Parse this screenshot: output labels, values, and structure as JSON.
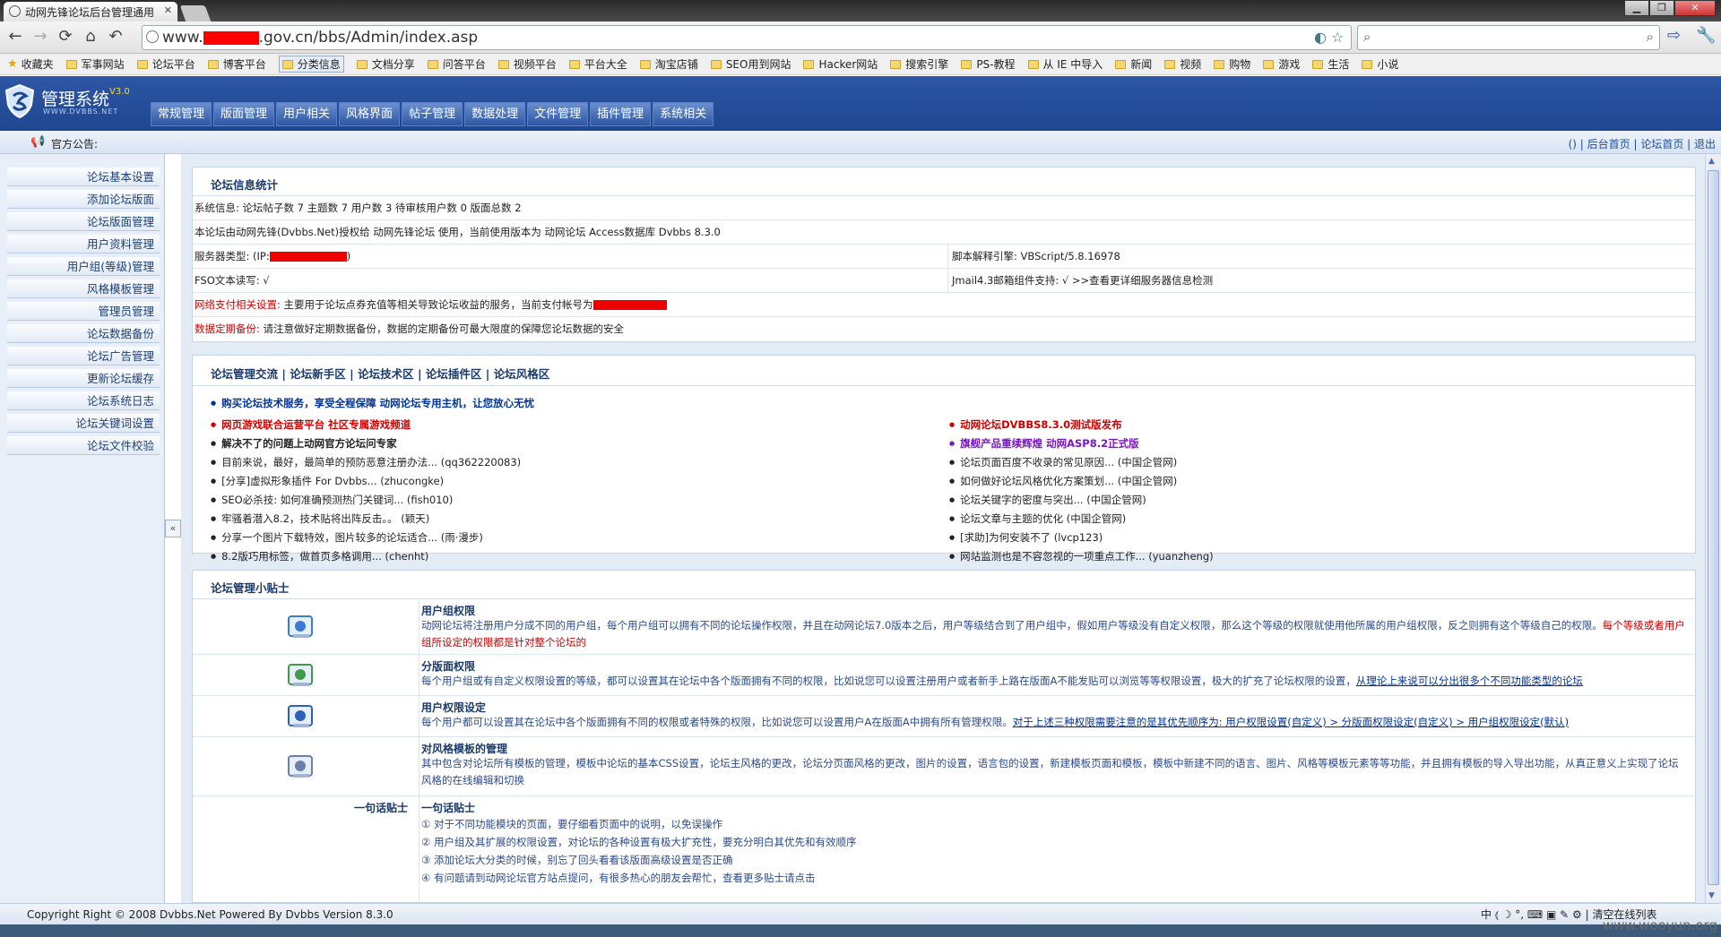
{
  "browser": {
    "tab_title": "动网先锋论坛后台管理通用",
    "url_prefix": "www.",
    "url_suffix": ".gov.cn/bbs/Admin/index.asp",
    "bookmarks": [
      "收藏夹",
      "军事网站",
      "论坛平台",
      "博客平台",
      "分类信息",
      "文档分享",
      "问答平台",
      "视频平台",
      "平台大全",
      "淘宝店铺",
      "SEO用到网站",
      "Hacker网站",
      "搜索引擎",
      "PS-教程",
      "从 IE 中导入",
      "新闻",
      "视频",
      "购物",
      "游戏",
      "生活",
      "小说"
    ]
  },
  "header": {
    "logo_title": "管理系统",
    "logo_version": "V3.0",
    "logo_sub": "WWW.DVBBS.NET",
    "menu": [
      "常规管理",
      "版面管理",
      "用户相关",
      "风格界面",
      "帖子管理",
      "数据处理",
      "文件管理",
      "插件管理",
      "系统相关"
    ]
  },
  "notice": {
    "label": "官方公告:",
    "links": "() | 后台首页 | 论坛首页 | 退出"
  },
  "sidebar": {
    "items": [
      "论坛基本设置",
      "添加论坛版面",
      "论坛版面管理",
      "用户资料管理",
      "用户组(等级)管理",
      "风格模板管理",
      "管理员管理",
      "论坛数据备份",
      "论坛广告管理",
      "更新论坛缓存",
      "论坛系统日志",
      "论坛关键词设置",
      "论坛文件校验"
    ],
    "collapse_label": "«"
  },
  "stats": {
    "title": "论坛信息统计",
    "system_info": "系统信息: 论坛帖子数 7 主题数 7 用户数 3 待审核用户数 0 版面总数 2",
    "license": "本论坛由动网先锋(Dvbbs.Net)授权给 动网先锋论坛 使用，当前使用版本为 动网论坛 Access数据库 Dvbbs 8.3.0",
    "server_type_label": "服务器类型: (IP:",
    "server_type_end": ")",
    "script_engine": "脚本解释引擎: VBScript/5.8.16978",
    "fso": "FSO文本读写: √",
    "jmail": "Jmail4.3邮箱组件支持: √   >>查看更详细服务器信息检测",
    "payment_label": "网络支付相关设置:",
    "payment_text": "主要用于论坛点券充值等相关导致论坛收益的服务，当前支付帐号为",
    "backup_label": "数据定期备份:",
    "backup_text": "请注意做好定期数据备份，数据的定期备份可最大限度的保障您论坛数据的安全"
  },
  "community": {
    "links": [
      "论坛管理交流",
      "论坛新手区",
      "论坛技术区",
      "论坛插件区",
      "论坛风格区"
    ],
    "separator": " | ",
    "headline": "购买论坛技术服务，享受全程保障   动网论坛专用主机，让您放心无忧",
    "left": [
      {
        "text": "网页游戏联合运营平台 社区专属游戏频道",
        "style": "red bold"
      },
      {
        "text": "解决不了的问题上动网官方论坛问专家",
        "style": "bold"
      },
      {
        "text": "目前来说，最好，最简单的预防恶意注册办法...  (qq362220083)",
        "style": ""
      },
      {
        "text": "[分享]虚拟形象插件 For Dvbbs...  (zhucongke)",
        "style": ""
      },
      {
        "text": "SEO必杀技: 如何准确预测热门关键词...  (fish010)",
        "style": ""
      },
      {
        "text": "牢骚着潜入8.2，技术贴将出阵反击。。  (颖天)",
        "style": ""
      },
      {
        "text": "分享一个图片下载特效，图片较多的论坛适合...  (雨·漫步)",
        "style": ""
      },
      {
        "text": "8.2版巧用标签，做首页多格调用...  (chenht)",
        "style": ""
      }
    ],
    "right": [
      {
        "text": "动网论坛DVBBS8.3.0测试版发布",
        "style": "red bold"
      },
      {
        "text": "旗舰产品重续辉煌 动网ASP8.2正式版",
        "style": "purple bold"
      },
      {
        "text": "论坛页面百度不收录的常见原因...  (中国企管网)",
        "style": ""
      },
      {
        "text": "如何做好论坛风格优化方案策划...  (中国企管网)",
        "style": ""
      },
      {
        "text": "论坛关键字的密度与突出...  (中国企管网)",
        "style": ""
      },
      {
        "text": "论坛文章与主题的优化  (中国企管网)",
        "style": ""
      },
      {
        "text": "[求助]为何安装不了  (lvcp123)",
        "style": ""
      },
      {
        "text": "网站监测也是不容忽视的一项重点工作...  (yuanzheng)",
        "style": ""
      }
    ]
  },
  "tips": {
    "title": "论坛管理小贴士",
    "items": [
      {
        "icon": "user-group-icon",
        "title": "用户组权限",
        "desc": "动网论坛将注册用户分成不同的用户组，每个用户组可以拥有不同的论坛操作权限，并且在动网论坛7.0版本之后，用户等级结合到了用户组中，假如用户等级没有自定义权限，那么这个等级的权限就使用他所属的用户组权限，反之则拥有这个等级自己的权限。",
        "desc_red": "每个等级或者用户组所设定的权限都是针对整个论坛的"
      },
      {
        "icon": "board-permission-icon",
        "title": "分版面权限",
        "desc": "每个用户组或有自定义权限设置的等级，都可以设置其在论坛中各个版面拥有不同的权限，比如说您可以设置注册用户或者新手上路在版面A不能发贴可以浏览等等权限设置，极大的扩充了论坛权限的设置，",
        "desc_blue": "从理论上来说可以分出很多个不同功能类型的论坛"
      },
      {
        "icon": "user-permission-icon",
        "title": "用户权限设定",
        "desc": "每个用户都可以设置其在论坛中各个版面拥有不同的权限或者特殊的权限，比如说您可以设置用户A在版面A中拥有所有管理权限。",
        "desc_blue": "对于上述三种权限需要注意的是其优先顺序为: 用户权限设置(自定义) > 分版面权限设定(自定义) > 用户组权限设定(默认)"
      },
      {
        "icon": "style-template-icon",
        "title": "对风格模板的管理",
        "desc": "其中包含对论坛所有模板的管理，模板中论坛的基本CSS设置，论坛主风格的更改，论坛分页面风格的更改，图片的设置，语言包的设置，新建模板页面和模板，模板中新建不同的语言、图片、风格等模板元素等等功能，并且拥有模板的导入导出功能，从真正意义上实现了论坛风格的在线编辑和切换"
      }
    ],
    "oneliner_label": "一句话贴士",
    "oneliner_title": "一句话贴士",
    "oneliners": [
      "① 对于不同功能模块的页面，要仔细看页面中的说明，以免误操作",
      "② 用户组及其扩展的权限设置，对论坛的各种设置有极大扩充性，要充分明白其优先和有效顺序",
      "③ 添加论坛大分类的时候，别忘了回头看看该版面高级设置是否正确",
      "④ 有问题请到动网论坛官方站点提问，有很多热心的朋友会帮忙，查看更多贴士请点击"
    ]
  },
  "footer": {
    "copyright": "Copyright Right © 2008 Dvbbs.Net Powered By Dvbbs Version 8.3.0",
    "ime": "中 ⦅ ☽ °, ⌨ ▣ ✎ ⚙",
    "clear": "清空在线列表"
  },
  "watermark": "www.wooyun.org",
  "colors": {
    "header_blue": "#2452a0",
    "sidebar_bg": "#e8eff8",
    "red": "#d00000"
  }
}
